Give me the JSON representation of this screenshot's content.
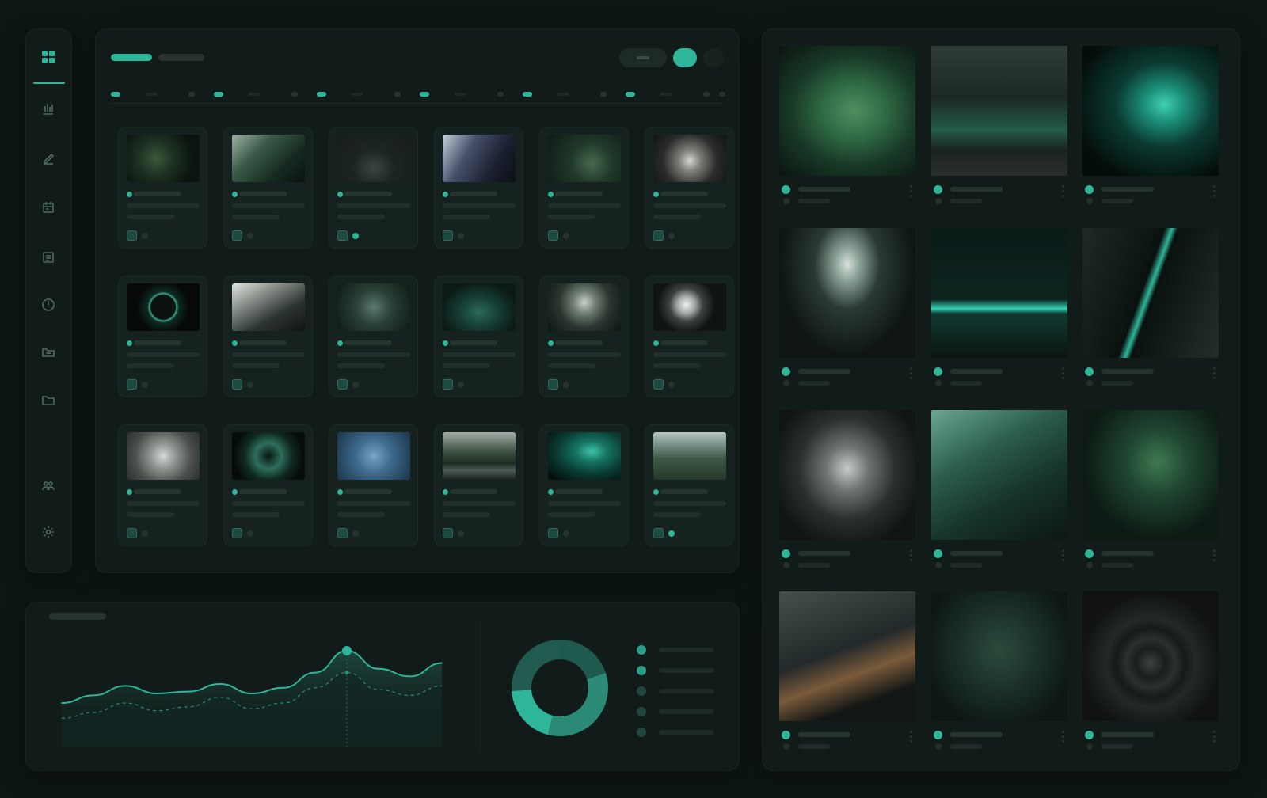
{
  "colors": {
    "background": "#0d1614",
    "panel": "#111c1a",
    "card": "#152220",
    "accent": "#2fb59a",
    "accent_dim": "#1f6b5c",
    "placeholder": "#22302d"
  },
  "sidebar": {
    "items": [
      {
        "icon": "dashboard-grid-icon",
        "active": true
      },
      {
        "icon": "bar-chart-icon",
        "active": false
      },
      {
        "icon": "edit-pencil-icon",
        "active": false
      },
      {
        "icon": "calendar-icon",
        "active": false
      },
      {
        "icon": "list-document-icon",
        "active": false
      },
      {
        "icon": "clock-icon",
        "active": false
      },
      {
        "icon": "inbox-folder-icon",
        "active": false
      },
      {
        "icon": "folder-icon",
        "active": false
      },
      {
        "icon": "team-users-icon",
        "active": false
      },
      {
        "icon": "settings-gear-icon",
        "active": false
      }
    ]
  },
  "grid_panel": {
    "tabs": [
      {
        "active": true
      },
      {
        "active": false
      }
    ],
    "toggles": [
      {
        "state": "off"
      },
      {
        "state": "on"
      },
      {
        "state": "off"
      }
    ],
    "ruler_segments": 6,
    "cards": [
      {
        "image": "dark-green-foliage",
        "icon": "image-icon",
        "active_status": false
      },
      {
        "image": "leaves-and-stone",
        "icon": "image-icon",
        "active_status": false
      },
      {
        "image": "dark-glass-bottle",
        "icon": "image-icon",
        "active_status": true
      },
      {
        "image": "modern-interior-blue",
        "icon": "folder-icon",
        "active_status": false
      },
      {
        "image": "tropical-leaves",
        "icon": "image-icon",
        "active_status": false
      },
      {
        "image": "ceramic-bowls-round",
        "icon": "image-icon",
        "active_status": false
      },
      {
        "image": "glowing-ring",
        "icon": "image-icon",
        "active_status": false
      },
      {
        "image": "architecture-angles",
        "icon": "image-icon",
        "active_status": false
      },
      {
        "image": "mossy-cave",
        "icon": "image-icon",
        "active_status": false
      },
      {
        "image": "green-heart-shape",
        "icon": "image-icon",
        "active_status": false
      },
      {
        "image": "cave-opening-round",
        "icon": "image-icon",
        "active_status": false
      },
      {
        "image": "pearl-sphere",
        "icon": "image-icon",
        "active_status": false
      },
      {
        "image": "sculpture-bust-gray",
        "icon": "image-icon",
        "active_status": false
      },
      {
        "image": "spiral-shell",
        "icon": "image-icon",
        "active_status": false
      },
      {
        "image": "blue-abstract",
        "icon": "image-icon",
        "active_status": false
      },
      {
        "image": "river-forest",
        "icon": "image-icon",
        "active_status": false
      },
      {
        "image": "teal-wave",
        "icon": "image-icon",
        "active_status": false
      },
      {
        "image": "misty-landscape",
        "icon": "image-icon",
        "active_status": true
      }
    ]
  },
  "gallery": {
    "items": [
      {
        "image": "wet-green-leaf"
      },
      {
        "image": "green-armchair-room"
      },
      {
        "image": "teal-light-swirl"
      },
      {
        "image": "cave-skylight-vines"
      },
      {
        "image": "teal-horizon-glow"
      },
      {
        "image": "dark-rock-canyon"
      },
      {
        "image": "laptop-on-stone"
      },
      {
        "image": "green-wave-lines"
      },
      {
        "image": "leafy-plant-stem"
      },
      {
        "image": "dark-building-facade"
      },
      {
        "image": "dark-bottle-leaves"
      },
      {
        "image": "water-drop-ripples"
      }
    ]
  },
  "analytics": {
    "chart_data": {
      "type": "line",
      "x": [
        0,
        1,
        2,
        3,
        4,
        5,
        6,
        7,
        8,
        9,
        10,
        11,
        12
      ],
      "series": [
        {
          "values": [
            30,
            38,
            48,
            40,
            42,
            50,
            40,
            46,
            62,
            85,
            66,
            58,
            72
          ]
        },
        {
          "values": [
            14,
            20,
            30,
            22,
            26,
            36,
            24,
            30,
            46,
            62,
            44,
            38,
            48
          ]
        }
      ],
      "highlight_index": 9,
      "ylim": [
        0,
        100
      ],
      "grid": false
    },
    "donut": {
      "type": "pie",
      "values": [
        20,
        34,
        20,
        26
      ],
      "colors": [
        "#1e5a4e",
        "#2a8a76",
        "#2fb59a",
        "#225c50"
      ]
    },
    "legend": [
      {
        "color": "#2fb59a"
      },
      {
        "color": "#2fb59a"
      },
      {
        "color": "#2a6b5d"
      },
      {
        "color": "#2a6b5d"
      },
      {
        "color": "#2a6b5d"
      }
    ]
  }
}
